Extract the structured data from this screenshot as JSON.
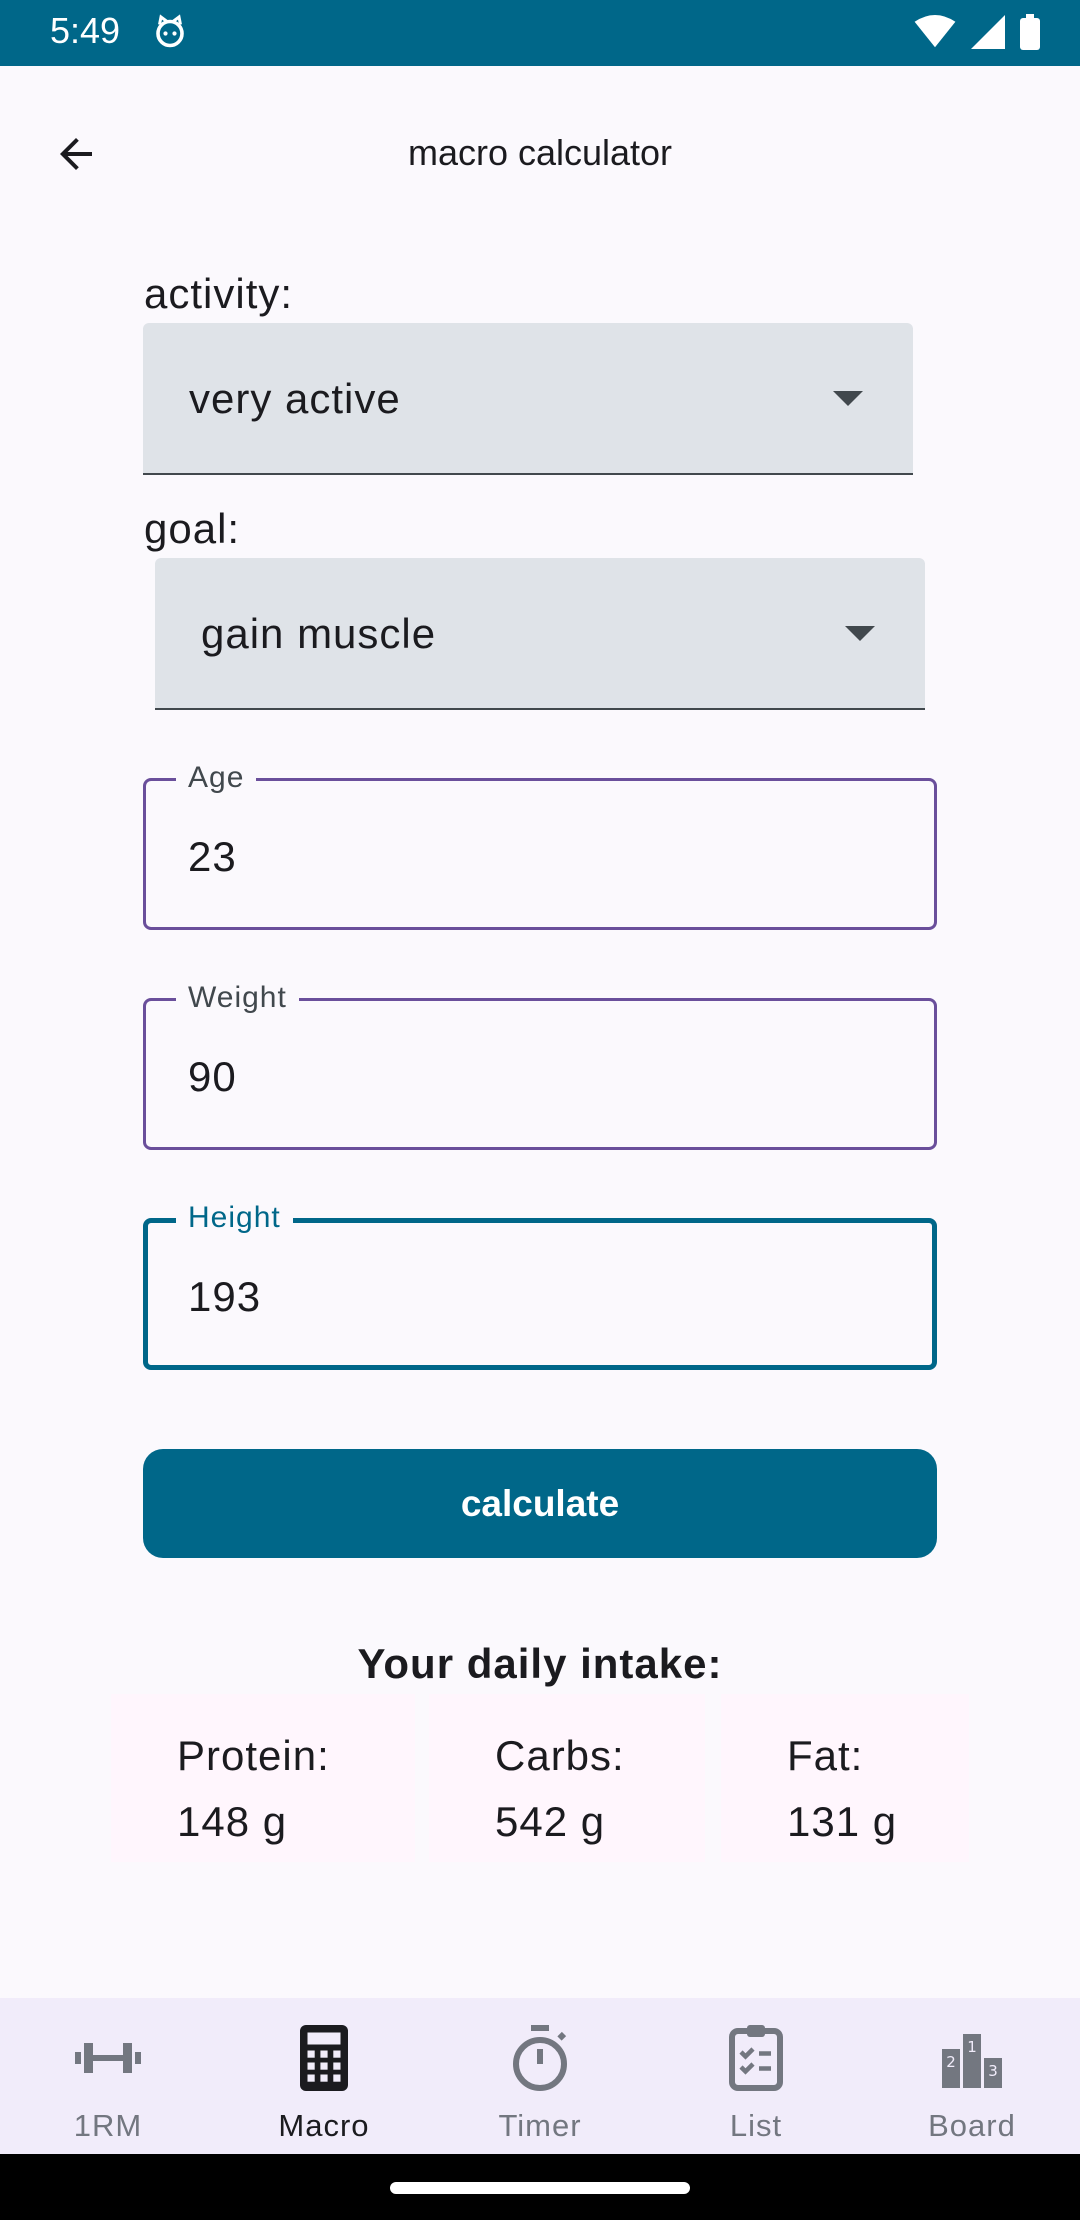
{
  "status_bar": {
    "time": "5:49"
  },
  "app_bar": {
    "title": "macro calculator"
  },
  "form": {
    "activity": {
      "label": "activity:",
      "value": "very active"
    },
    "goal": {
      "label": "goal:",
      "value": "gain muscle"
    },
    "age": {
      "label": "Age",
      "value": "23"
    },
    "weight": {
      "label": "Weight",
      "value": "90"
    },
    "height": {
      "label": "Height",
      "value": "193"
    },
    "calculate_label": "calculate"
  },
  "results": {
    "title": "Your daily intake:",
    "cards": [
      {
        "label": "Protein:",
        "value": "148 g"
      },
      {
        "label": "Carbs:",
        "value": "542 g"
      },
      {
        "label": "Fat:",
        "value": "131 g"
      }
    ]
  },
  "bottom_nav": {
    "items": [
      {
        "label": "1RM",
        "icon": "dumbbell-icon"
      },
      {
        "label": "Macro",
        "icon": "calculator-icon",
        "active": true
      },
      {
        "label": "Timer",
        "icon": "stopwatch-icon"
      },
      {
        "label": "List",
        "icon": "checklist-icon"
      },
      {
        "label": "Board",
        "icon": "leaderboard-icon"
      }
    ]
  },
  "colors": {
    "primary": "#006789",
    "outline": "#6a4f9b",
    "surface": "#fbf9fd",
    "dropdown_bg": "#dfe3e8",
    "nav_bg": "#f1ecfa"
  }
}
